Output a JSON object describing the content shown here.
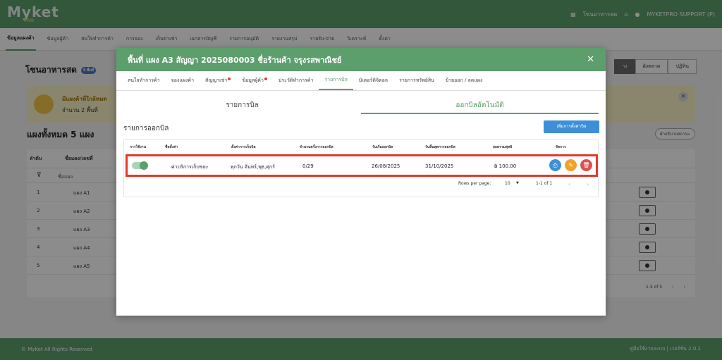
{
  "app": {
    "logo": "Myket",
    "logo_sub": "PRO",
    "market_name": "โซนอาหารสด",
    "user": "MYKETPRO SUPPORT (P)"
  },
  "nav": [
    "ข้อมูลแผงค้า",
    "ข้อมูลผู้ค้า",
    "สนใจทำการค้า",
    "การจอง",
    "เก็บค่าเช่า",
    "เอกสารบัญชี",
    "รายการอนุมัติ",
    "รายงานสรุป",
    "รายรับ-จ่าย",
    "วิเคราะห์",
    "ตั้งค่า"
  ],
  "page": {
    "title": "โซนอาหารสด",
    "title_badge": "5 พื้นที่",
    "tabs": [
      "าง",
      "ผังตลาด",
      "ปฏิทิน"
    ],
    "notice_title": "มีแผงค้าที่ใกล้หมด",
    "notice_count": "จำนวน 2 พื้นที่",
    "stall_count": "แผงทั้งหมด 5 แผง",
    "status_button": "คำอธิบายสถานะ",
    "table_headers": [
      "ลำดับ",
      "ชื่อแผง/เลขที่"
    ],
    "filter_placeholder": "ชื่อแผง",
    "rows": [
      {
        "no": "1",
        "name": "แผง A1"
      },
      {
        "no": "2",
        "name": "แผง A2"
      },
      {
        "no": "3",
        "name": "แผง A3"
      },
      {
        "no": "4",
        "name": "แผง A4"
      },
      {
        "no": "5",
        "name": "แผง A5"
      }
    ],
    "pager": "1-5 of 5"
  },
  "footer": {
    "left": "© MyKet All Rights Reserved",
    "right": "คู่มือใช้งานระบบ | เวอร์ชั่น 2.0.1"
  },
  "modal": {
    "title": "พื้นที่ แผง A3 สัญญา 2025080003 ชื่อร้านค้า จรุงรสพาณิชย์",
    "tabs": [
      {
        "label": "สนใจทำการค้า",
        "dot": false,
        "active": false
      },
      {
        "label": "จองแผงค้า",
        "dot": false,
        "active": false
      },
      {
        "label": "สัญญาเช่า",
        "dot": true,
        "active": false
      },
      {
        "label": "ข้อมูลผู้ค้า",
        "dot": true,
        "active": false
      },
      {
        "label": "ประวัติทำการค้า",
        "dot": false,
        "active": false
      },
      {
        "label": "รายการบิล",
        "dot": false,
        "active": true
      },
      {
        "label": "มิเตอร์ดิจิตอล",
        "dot": false,
        "active": false
      },
      {
        "label": "รายการทรัพย์สิน",
        "dot": false,
        "active": false
      },
      {
        "label": "ย้ายออก / ลดแผง",
        "dot": false,
        "active": false
      }
    ],
    "subtabs": {
      "bills": "รายการบิล",
      "auto": "ออกบิลอัตโนมัติ"
    },
    "section_title": "รายการออกบิล",
    "add_button": "เพิ่มการตั้งค่าบิล",
    "columns": [
      "การใช้งาน",
      "ชื่อตั้งค่า",
      "ตั้งค่าการเก็บบิล",
      "จำนวนครั้งการออกบิล",
      "วันเริ่มออกบิล",
      "วันสิ้นสุดการออกบิล",
      "ยอดรวมสุทธิ",
      "จัดการ"
    ],
    "bill_row": {
      "enabled": true,
      "name": "ค่าบริการเก็บขยะ",
      "schedule": "ทุกวัน จันทร์,พุธ,ศุกร์",
      "count": "0/29",
      "start": "26/08/2025",
      "end": "31/10/2025",
      "total": "฿ 100.00"
    },
    "pager": {
      "rows_label": "Rows per page:",
      "rows_value": "10",
      "range": "1-1 of 1"
    }
  }
}
